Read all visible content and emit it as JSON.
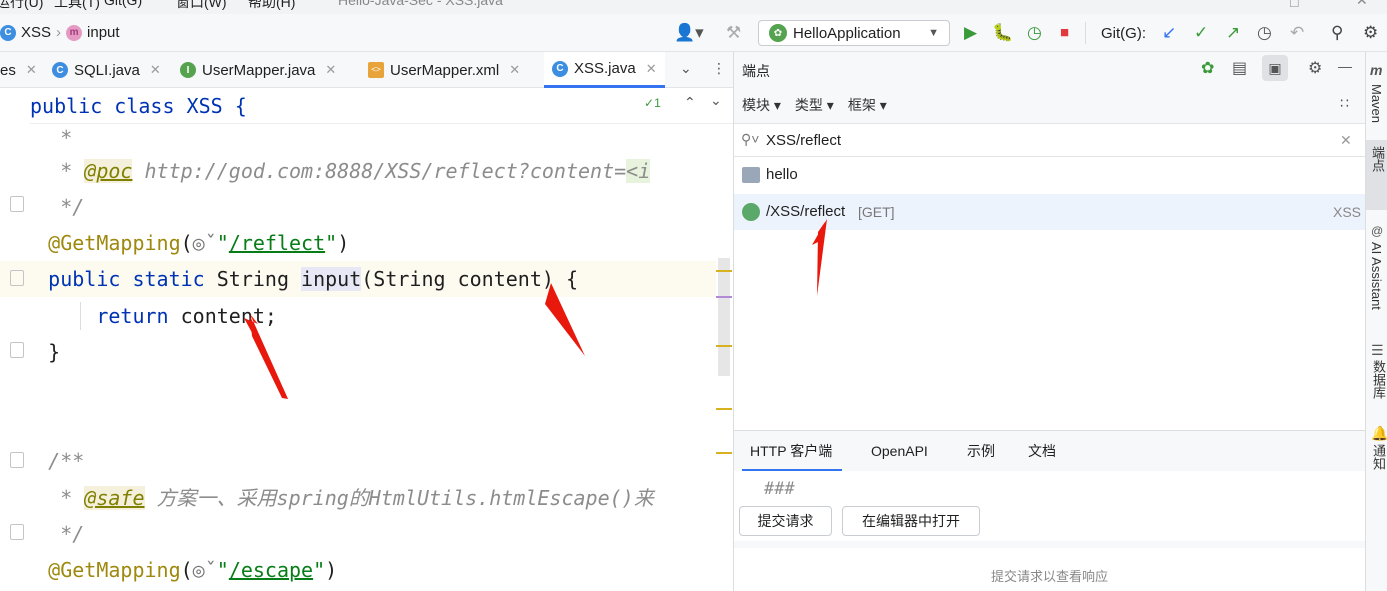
{
  "menubar": {
    "items": [
      "运行(U)",
      "工具(T)",
      "Git(G)",
      "窗口(W)",
      "帮助(H)"
    ],
    "window_title": "Hello-Java-Sec - XSS.java"
  },
  "navbar": {
    "crumb1": "XSS",
    "crumb2": "input",
    "run_config": "HelloApplication",
    "git_label": "Git(G):"
  },
  "tabs": [
    {
      "label": "es",
      "icon": "C"
    },
    {
      "label": "SQLI.java",
      "icon": "C"
    },
    {
      "label": "UserMapper.java",
      "icon": "I"
    },
    {
      "label": "UserMapper.xml",
      "icon": "xml"
    },
    {
      "label": "XSS.java",
      "icon": "C"
    }
  ],
  "editor": {
    "header_line": "public class XSS {",
    "inspection_count": "1",
    "lines": [
      "     *",
      "     * @poc http://god.com:8888/XSS/reflect?content=<i",
      "     */",
      "    @GetMapping(©˅\"/reflect\")",
      "    public static String input(String content) {",
      "        return content;",
      "    }",
      "",
      "",
      "    /**",
      "     * @safe 方案一、采用spring的HtmlUtils.htmlEscape()来",
      "     */",
      "    @GetMapping(©˅\"/escape\")"
    ]
  },
  "endpoints_panel": {
    "title": "端点",
    "filters": [
      "模块 ▾",
      "类型 ▾",
      "框架 ▾"
    ],
    "search_value": "XSS/reflect",
    "group": "hello",
    "endpoint_path": "/XSS/reflect",
    "endpoint_method": "[GET]",
    "endpoint_class": "XSS",
    "bottom_tabs": [
      "HTTP 客户端",
      "OpenAPI",
      "示例",
      "文档"
    ],
    "http_code": "###",
    "submit_button": "提交请求",
    "open_in_editor_button": "在编辑器中打开",
    "response_hint": "提交请求以查看响应"
  },
  "right_strip": {
    "items": [
      "Maven",
      "端点",
      "AI Assistant",
      "数据库",
      "通知"
    ]
  },
  "colors": {
    "accent": "#3574f0",
    "keyword": "#0033b3",
    "annotation": "#9e880d",
    "string": "#067d17",
    "arrow": "#e8180c"
  }
}
